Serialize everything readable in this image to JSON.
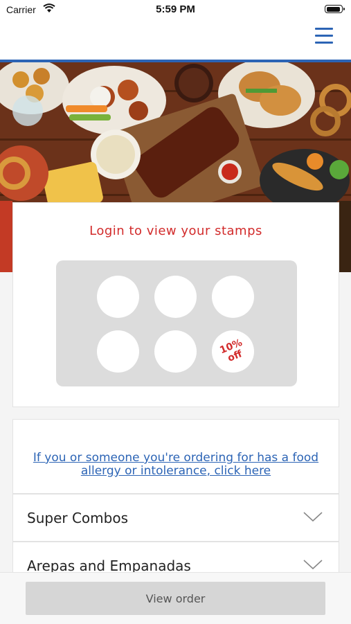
{
  "status_bar": {
    "carrier": "Carrier",
    "time": "5:59 PM"
  },
  "navbar": {
    "menu_icon": "hamburger-menu-icon",
    "accent_color": "#2c64b5"
  },
  "hero": {
    "image": "food-spread-photo"
  },
  "stamps": {
    "title": "Login to view your stamps",
    "reward_line1": "10%",
    "reward_line2": "off",
    "total": 6
  },
  "allergy": {
    "link_text": "If you or someone you're ordering for has a food allergy or intolerance, click here"
  },
  "menu": {
    "sections": [
      {
        "label": "Super Combos"
      },
      {
        "label": "Arepas and Empanadas"
      }
    ]
  },
  "bottom": {
    "view_order_label": "View order"
  }
}
